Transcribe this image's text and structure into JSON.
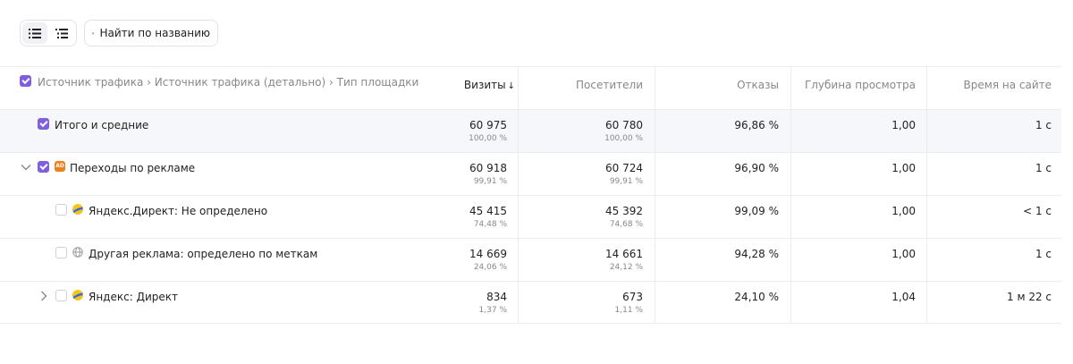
{
  "search": {
    "placeholder": "Найти по названию"
  },
  "header": {
    "dimensions": "Источник трафика › Источник трафика (детально) › Тип площадки",
    "visits": "Визиты",
    "sort_arrow": "↓",
    "visitors": "Посетители",
    "bounces": "Отказы",
    "depth": "Глубина просмотра",
    "time": "Время на сайте"
  },
  "rows": [
    {
      "label": "Итого и средние",
      "visits": "60 975",
      "visits_pct": "100,00 %",
      "visitors": "60 780",
      "visitors_pct": "100,00 %",
      "bounces": "96,86 %",
      "depth": "1,00",
      "time": "1 с"
    },
    {
      "label": "Переходы по рекламе",
      "badge": "AD",
      "visits": "60 918",
      "visits_pct": "99,91 %",
      "visitors": "60 724",
      "visitors_pct": "99,91 %",
      "bounces": "96,90 %",
      "depth": "1,00",
      "time": "1 с"
    },
    {
      "label": "Яндекс.Директ: Не определено",
      "visits": "45 415",
      "visits_pct": "74,48 %",
      "visitors": "45 392",
      "visitors_pct": "74,68 %",
      "bounces": "99,09 %",
      "depth": "1,00",
      "time": "< 1 с"
    },
    {
      "label": "Другая реклама: определено по меткам",
      "visits": "14 669",
      "visits_pct": "24,06 %",
      "visitors": "14 661",
      "visitors_pct": "24,12 %",
      "bounces": "94,28 %",
      "depth": "1,00",
      "time": "1 с"
    },
    {
      "label": "Яндекс: Директ",
      "visits": "834",
      "visits_pct": "1,37 %",
      "visitors": "673",
      "visitors_pct": "1,11 %",
      "bounces": "24,10 %",
      "depth": "1,04",
      "time": "1 м 22 с"
    }
  ],
  "colors": {
    "accent": "#7f5fdf",
    "ad_badge": "#f0801e",
    "yandex_yellow": "#f5c518",
    "yandex_blue": "#3a6be0"
  }
}
